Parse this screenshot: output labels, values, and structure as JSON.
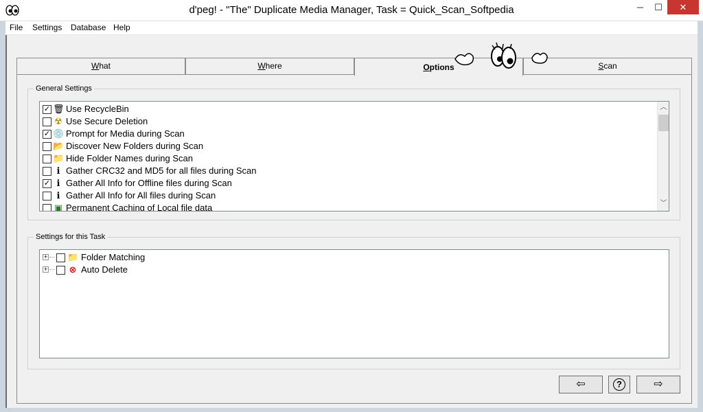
{
  "window": {
    "title": "d'peg! - \"The\" Duplicate Media Manager, Task = Quick_Scan_Softpedia",
    "minimize": "─",
    "maximize": "☐",
    "close": "✕"
  },
  "menu": [
    "File",
    "Settings",
    "Database",
    "Help"
  ],
  "tabs": [
    {
      "label": "What",
      "u": "W",
      "rest": "hat"
    },
    {
      "label": "Where",
      "u": "W",
      "rest": "here"
    },
    {
      "label": "Options",
      "u": "O",
      "rest": "ptions"
    },
    {
      "label": "Scan",
      "u": "S",
      "rest": "can"
    }
  ],
  "general_settings": {
    "title": "General Settings",
    "items": [
      {
        "label": "Use RecycleBin",
        "checked": true,
        "icon": "recycle-bin-icon",
        "glyph": "🗑"
      },
      {
        "label": "Use Secure Deletion",
        "checked": false,
        "icon": "radiation-icon",
        "glyph": "☢"
      },
      {
        "label": "Prompt for Media during Scan",
        "checked": true,
        "icon": "disc-icon",
        "glyph": "💿"
      },
      {
        "label": "Discover New Folders during Scan",
        "checked": false,
        "icon": "new-folder-icon",
        "glyph": "📂"
      },
      {
        "label": "Hide Folder Names during Scan",
        "checked": false,
        "icon": "folder-icon",
        "glyph": "📁"
      },
      {
        "label": "Gather CRC32 and MD5 for all files during Scan",
        "checked": false,
        "icon": "info-icon",
        "glyph": "ℹ"
      },
      {
        "label": "Gather All Info for Offline files during Scan",
        "checked": true,
        "icon": "info-icon",
        "glyph": "ℹ"
      },
      {
        "label": "Gather All Info for All files during Scan",
        "checked": false,
        "icon": "info-icon",
        "glyph": "ℹ"
      },
      {
        "label": "Permanent Caching of Local file data",
        "checked": false,
        "icon": "cache-icon",
        "glyph": "▣"
      }
    ]
  },
  "task_settings": {
    "title": "Settings for this Task",
    "items": [
      {
        "label": "Folder Matching",
        "checked": false,
        "icon": "folder-icon",
        "glyph": "📁",
        "expander": "+"
      },
      {
        "label": "Auto Delete",
        "checked": false,
        "icon": "stop-icon",
        "glyph": "⊗",
        "expander": "+"
      }
    ]
  },
  "nav": {
    "back": "⇦",
    "help": "?",
    "next": "⇨"
  },
  "colors": {
    "close_red": "#c7372f",
    "tab_border": "#8c8c8c"
  }
}
